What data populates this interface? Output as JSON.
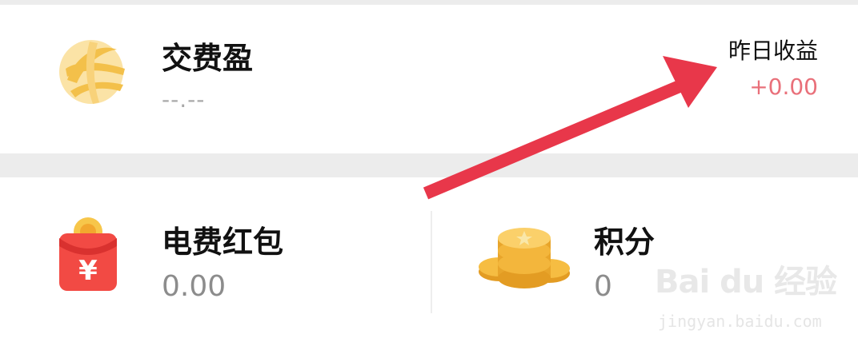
{
  "product": {
    "name": "交费盈",
    "value": "--.--",
    "yesterday_label": "昨日收益",
    "yesterday_value": "+0.00"
  },
  "tiles": [
    {
      "label": "电费红包",
      "value": "0.00",
      "icon": "red-envelope-icon"
    },
    {
      "label": "积分",
      "value": "0",
      "icon": "coin-stack-icon"
    }
  ],
  "watermark": {
    "brand": "Bai du 经验",
    "url": "jingyan.baidu.com"
  },
  "colors": {
    "accent_red": "#e8374a",
    "positive_value": "#e9707a",
    "logo_gold": "#f3c04a"
  }
}
